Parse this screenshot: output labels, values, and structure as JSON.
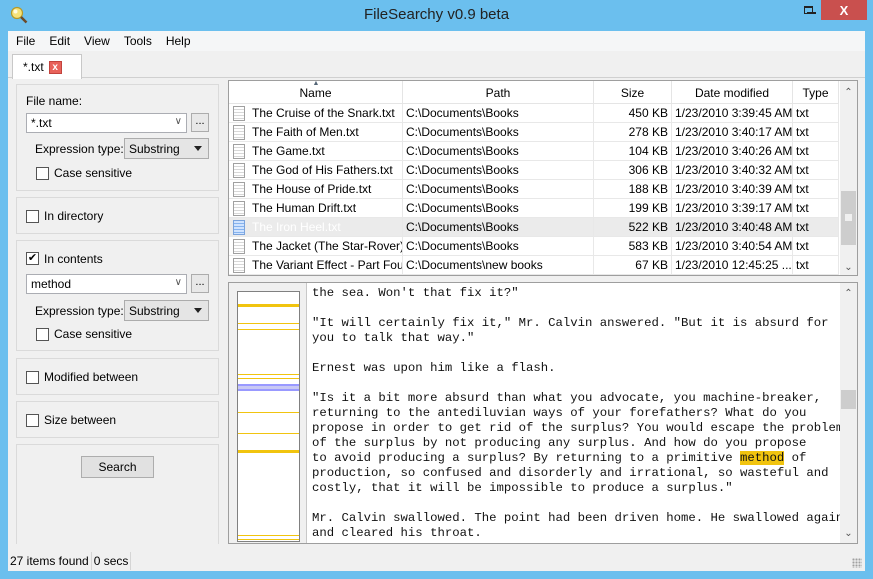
{
  "window": {
    "title": "FileSearchy v0.9 beta",
    "controls": {
      "minimize": "–",
      "maximize": "□",
      "close": "X"
    }
  },
  "menu": [
    "File",
    "Edit",
    "View",
    "Tools",
    "Help"
  ],
  "tabs": [
    {
      "label": "*.txt",
      "close": "x"
    }
  ],
  "filters": {
    "file_name": {
      "label": "File name:",
      "value": "*.txt",
      "browse_label": "...",
      "expression_label": "Expression type:",
      "expression_value": "Substring",
      "case_sensitive_label": "Case sensitive",
      "case_sensitive": false
    },
    "in_directory": {
      "label": "In directory",
      "checked": false
    },
    "in_contents": {
      "label": "In contents",
      "checked": true,
      "value": "method",
      "browse_label": "...",
      "expression_label": "Expression type:",
      "expression_value": "Substring",
      "case_sensitive_label": "Case sensitive",
      "case_sensitive": false
    },
    "modified_between": {
      "label": "Modified between",
      "checked": false
    },
    "size_between": {
      "label": "Size between",
      "checked": false
    },
    "search_button": "Search"
  },
  "results": {
    "columns": [
      "Name",
      "Path",
      "Size",
      "Date modified",
      "Type"
    ],
    "sorted_by": "Name",
    "rows": [
      {
        "name": "The Cruise of the Snark.txt",
        "path": "C:\\Documents\\Books",
        "size": "450 KB",
        "date": "1/23/2010 3:39:45 AM",
        "type": "txt"
      },
      {
        "name": "The Faith of Men.txt",
        "path": "C:\\Documents\\Books",
        "size": "278 KB",
        "date": "1/23/2010 3:40:17 AM",
        "type": "txt"
      },
      {
        "name": "The Game.txt",
        "path": "C:\\Documents\\Books",
        "size": "104 KB",
        "date": "1/23/2010 3:40:26 AM",
        "type": "txt"
      },
      {
        "name": "The God of His Fathers.txt",
        "path": "C:\\Documents\\Books",
        "size": "306 KB",
        "date": "1/23/2010 3:40:32 AM",
        "type": "txt"
      },
      {
        "name": "The House of Pride.txt",
        "path": "C:\\Documents\\Books",
        "size": "188 KB",
        "date": "1/23/2010 3:40:39 AM",
        "type": "txt"
      },
      {
        "name": "The Human Drift.txt",
        "path": "C:\\Documents\\Books",
        "size": "199 KB",
        "date": "1/23/2010 3:39:17 AM",
        "type": "txt"
      },
      {
        "name": "The Iron Heel.txt",
        "path": "C:\\Documents\\Books",
        "size": "522 KB",
        "date": "1/23/2010 3:40:48 AM",
        "type": "txt",
        "selected": true
      },
      {
        "name": "The Jacket (The Star-Rover).txt",
        "path": "C:\\Documents\\Books",
        "size": "583 KB",
        "date": "1/23/2010 3:40:54 AM",
        "type": "txt"
      },
      {
        "name": "The Variant Effect - Part Four_",
        "path": "C:\\Documents\\new books",
        "size": "67 KB",
        "date": "1/23/2010 12:45:25 ...",
        "type": "txt"
      }
    ]
  },
  "preview": {
    "highlight_term": "method",
    "lines": [
      "the sea. Won't that fix it?\"",
      "",
      "\"It will certainly fix it,\" Mr. Calvin answered. \"But it is absurd for",
      "you to talk that way.\"",
      "",
      "Ernest was upon him like a flash.",
      "",
      "\"Is it a bit more absurd than what you advocate, you machine-breaker,",
      "returning to the antediluvian ways of your forefathers? What do you",
      "propose in order to get rid of the surplus? You would escape the problem",
      "of the surplus by not producing any surplus. And how do you propose",
      "to avoid producing a surplus? By returning to a primitive method of",
      "production, so confused and disorderly and irrational, so wasteful and",
      "costly, that it will be impossible to produce a surplus.\"",
      "",
      "Mr. Calvin swallowed. The point had been driven home. He swallowed again",
      "and cleared his throat."
    ],
    "minimap_marks": [
      {
        "pos": 0.05,
        "kind": "match-strong"
      },
      {
        "pos": 0.125,
        "kind": "match"
      },
      {
        "pos": 0.15,
        "kind": "match"
      },
      {
        "pos": 0.33,
        "kind": "match"
      },
      {
        "pos": 0.345,
        "kind": "match"
      },
      {
        "pos": 0.37,
        "kind": "viewport"
      },
      {
        "pos": 0.48,
        "kind": "match"
      },
      {
        "pos": 0.565,
        "kind": "match"
      },
      {
        "pos": 0.635,
        "kind": "match-strong"
      },
      {
        "pos": 0.975,
        "kind": "match"
      },
      {
        "pos": 0.99,
        "kind": "match"
      }
    ]
  },
  "status": {
    "items_found": "27 items found",
    "elapsed": "0 secs"
  },
  "colors": {
    "titlebar": "#6bbfee",
    "close_button": "#c9504e",
    "highlight": "#f1c40f",
    "minimap_viewport": "#9999ff"
  }
}
